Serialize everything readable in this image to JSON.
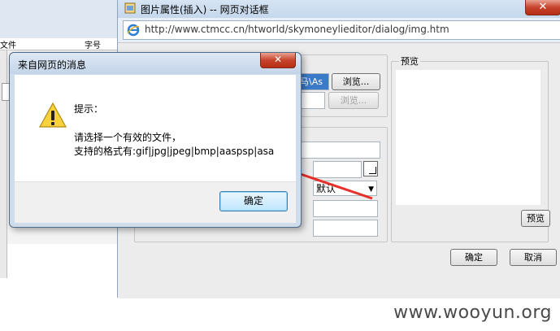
{
  "background_app": {
    "partial_text": "文件",
    "partial_text_right": "字号"
  },
  "dialog": {
    "title": "图片属性(插入) -- 网页对话框",
    "close_label": "✕",
    "address_url": "http://www.ctmcc.cn/htworld/skymoneylieditor/dialog/img.htm",
    "path_fragment": "马\\As",
    "browse_label": "浏览...",
    "browse_disabled_label": "浏览...",
    "preview_legend": "预览",
    "preview_button": "预览",
    "align_value": "默认",
    "ok_label": "确定",
    "cancel_label": "取消"
  },
  "message_box": {
    "title": "来自网页的消息",
    "close_label": "✕",
    "line1": "提示：",
    "line2": "请选择一个有效的文件，",
    "line3": "支持的格式有:gif|jpg|jpeg|bmp|aaspsp|asa",
    "ok_label": "确定",
    "icon": "warning-icon"
  },
  "annotation": {
    "arrow_color": "#e8302a"
  },
  "watermark": "www.wooyun.org"
}
